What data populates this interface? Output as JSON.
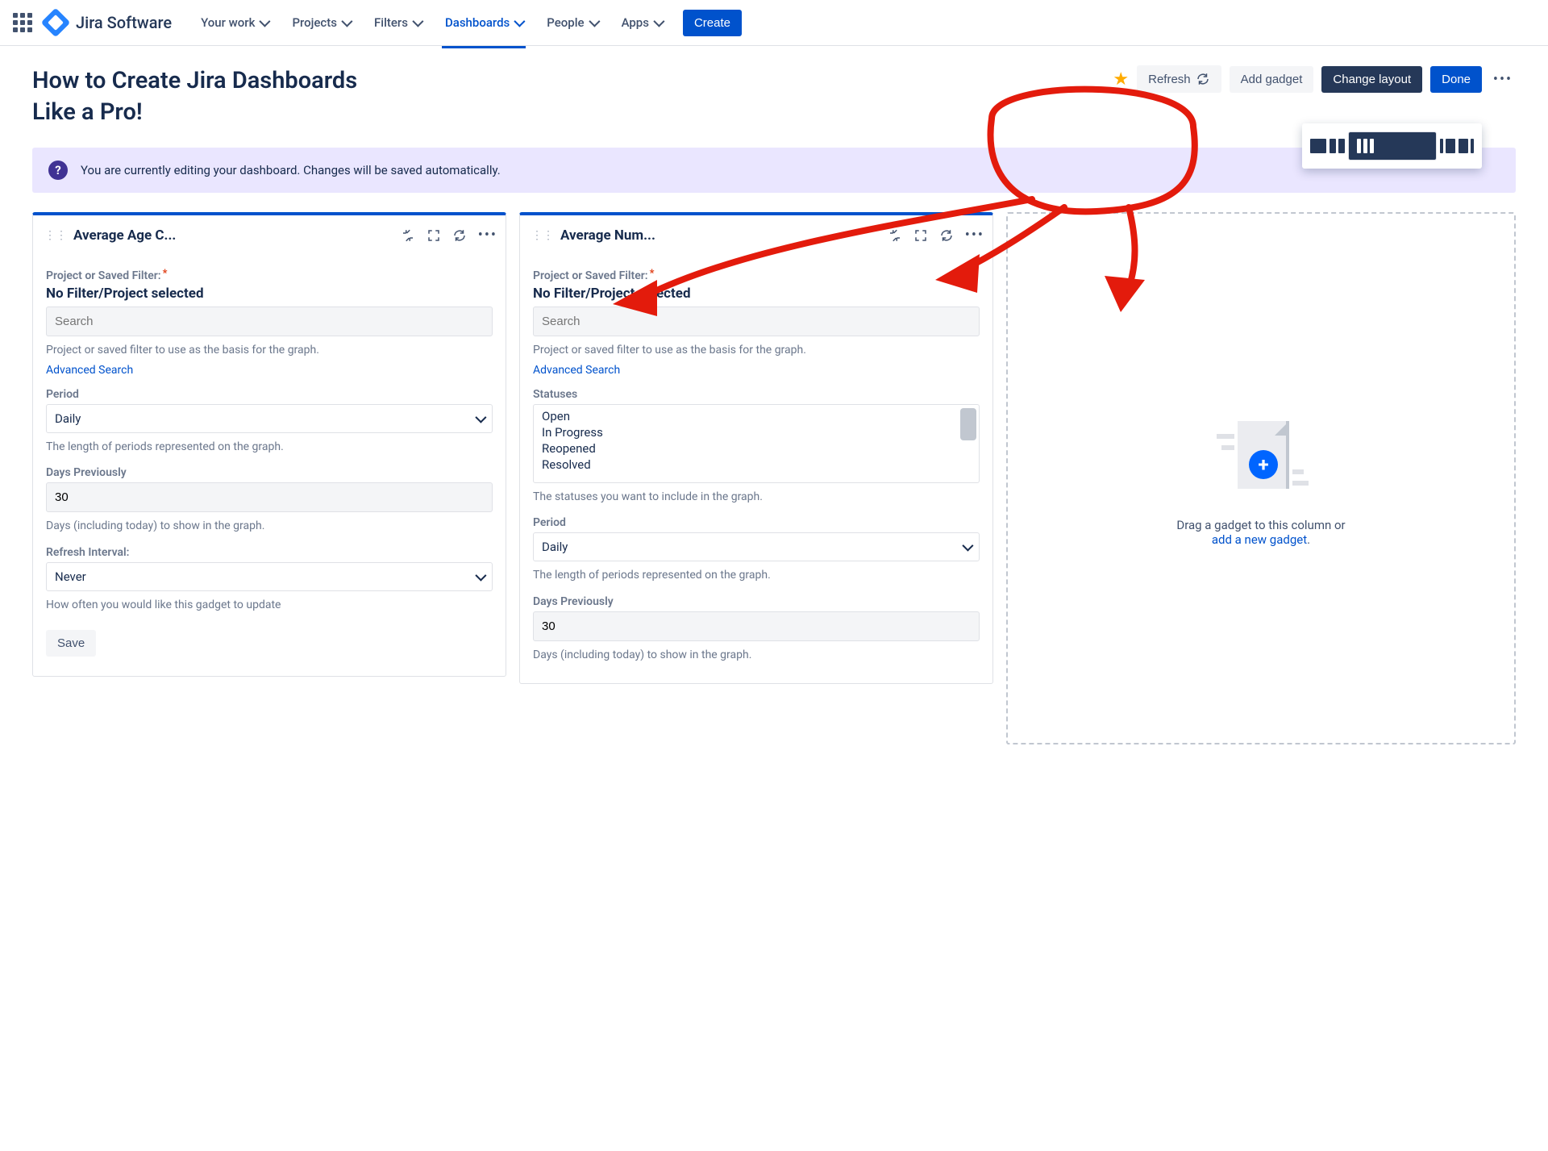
{
  "brand": "Jira Software",
  "nav": {
    "items": [
      "Your work",
      "Projects",
      "Filters",
      "Dashboards",
      "People",
      "Apps"
    ],
    "active_index": 3,
    "create": "Create"
  },
  "page_title": "How to Create Jira Dashboards Like a Pro!",
  "actions": {
    "refresh": "Refresh",
    "add_gadget": "Add gadget",
    "change_layout": "Change layout",
    "done": "Done"
  },
  "banner_text": "You are currently editing your dashboard. Changes will be saved automatically.",
  "gadget1": {
    "title": "Average Age C...",
    "filter_label": "Project or Saved Filter:",
    "nofilter": "No Filter/Project selected",
    "search_ph": "Search",
    "filter_help": "Project or saved filter to use as the basis for the graph.",
    "advanced": "Advanced Search",
    "period_label": "Period",
    "period_value": "Daily",
    "period_help": "The length of periods represented on the graph.",
    "days_label": "Days Previously",
    "days_value": "30",
    "days_help": "Days (including today) to show in the graph.",
    "refresh_label": "Refresh Interval:",
    "refresh_value": "Never",
    "refresh_help": "How often you would like this gadget to update",
    "save": "Save"
  },
  "gadget2": {
    "title": "Average Num...",
    "filter_label": "Project or Saved Filter:",
    "nofilter": "No Filter/Project selected",
    "search_ph": "Search",
    "filter_help": "Project or saved filter to use as the basis for the graph.",
    "advanced": "Advanced Search",
    "statuses_label": "Statuses",
    "statuses": [
      "Open",
      "In Progress",
      "Reopened",
      "Resolved"
    ],
    "statuses_help": "The statuses you want to include in the graph.",
    "period_label": "Period",
    "period_value": "Daily",
    "period_help": "The length of periods represented on the graph.",
    "days_label": "Days Previously",
    "days_value": "30",
    "days_help": "Days (including today) to show in the graph."
  },
  "empty_col": {
    "line1": "Drag a gadget to this column or",
    "link": "add a new gadget"
  }
}
